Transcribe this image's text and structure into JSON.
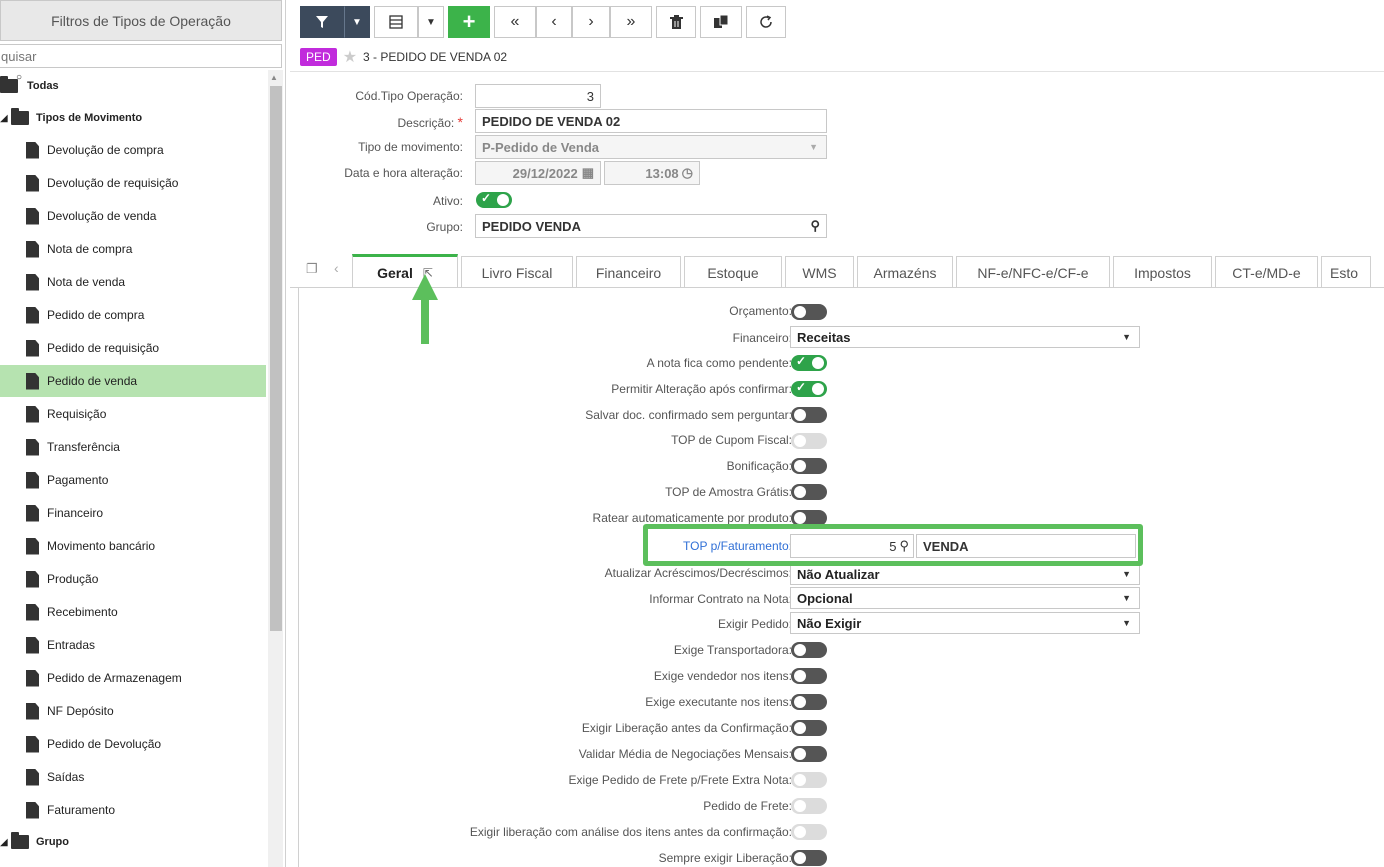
{
  "left_panel": {
    "title": "Filtros de Tipos de Operação",
    "search_placeholder": "quisar",
    "root": "Todas",
    "group_movements": "Tipos de Movimento",
    "items": [
      "Devolução de compra",
      "Devolução de requisição",
      "Devolução de venda",
      "Nota de compra",
      "Nota de venda",
      "Pedido de compra",
      "Pedido de requisição",
      "Pedido de venda",
      "Requisição",
      "Transferência",
      "Pagamento",
      "Financeiro",
      "Movimento bancário",
      "Produção",
      "Recebimento",
      "Entradas",
      "Pedido de Armazenagem",
      "NF Depósito",
      "Pedido de Devolução",
      "Saídas",
      "Faturamento"
    ],
    "selected_index": 7,
    "group_other": "Grupo"
  },
  "toolbar": {
    "icons": [
      "filter-icon",
      "caret-down-icon",
      "grid-icon",
      "caret-down-icon",
      "plus-icon",
      "first-icon",
      "prev-icon",
      "next-icon",
      "last-icon",
      "trash-icon",
      "copy-icon",
      "refresh-icon"
    ]
  },
  "record": {
    "badge": "PED",
    "title": "3 - PEDIDO DE VENDA 02"
  },
  "header_form": {
    "cod_label": "Cód.Tipo Operação:",
    "cod_value": "3",
    "desc_label": "Descrição:",
    "desc_required": "*",
    "desc_value": "PEDIDO DE VENDA 02",
    "tipo_label": "Tipo de movimento:",
    "tipo_value": "P-Pedido de Venda",
    "data_label": "Data e hora alteração:",
    "data_date": "29/12/2022",
    "data_time": "13:08",
    "ativo_label": "Ativo:",
    "ativo_on": true,
    "grupo_label": "Grupo:",
    "grupo_value": "PEDIDO VENDA"
  },
  "tabs": [
    "Geral",
    "Livro Fiscal",
    "Financeiro",
    "Estoque",
    "WMS",
    "Armazéns",
    "NF-e/NFC-e/CF-e",
    "Impostos",
    "CT-e/MD-e",
    "Esto"
  ],
  "active_tab": "Geral",
  "geral": {
    "orcamento": "Orçamento:",
    "financeiro_label": "Financeiro:",
    "financeiro_value": "Receitas",
    "nota_pendente": "A nota fica como pendente:",
    "permitir_alteracao": "Permitir Alteração após confirmar:",
    "salvar_doc": "Salvar doc. confirmado sem perguntar:",
    "top_cupom": "TOP de Cupom Fiscal:",
    "bonificacao": "Bonificação:",
    "top_amostra": "TOP de Amostra Grátis:",
    "ratear": "Ratear automaticamente por produto:",
    "top_faturamento_label": "TOP p/Faturamento:",
    "top_faturamento_code": "5",
    "top_faturamento_desc": "VENDA",
    "atualizar_label": "Atualizar Acréscimos/Decréscimos:",
    "atualizar_value": "Não Atualizar",
    "contrato_label": "Informar Contrato na Nota:",
    "contrato_value": "Opcional",
    "exige_pedido_label": "Exigir Pedido:",
    "exige_pedido_value": "Não Exigir",
    "exige_transp": "Exige Transportadora:",
    "exige_vendedor": "Exige vendedor nos itens:",
    "exige_executante": "Exige executante nos itens:",
    "exigir_liberacao": "Exigir Liberação antes da Confirmação:",
    "validar_media": "Validar Média de Negociações Mensais:",
    "exige_frete": "Exige Pedido de Frete p/Frete Extra Nota:",
    "pedido_frete": "Pedido de Frete:",
    "exigir_lib_analise": "Exigir liberação com análise dos itens antes da confirmação:",
    "sempre_exigir": "Sempre exigir Liberação:"
  },
  "colors": {
    "accent_green": "#3cb34a",
    "highlight": "#5cbf5c",
    "badge": "#c12bdc",
    "selected_row": "#b6e3b0"
  }
}
